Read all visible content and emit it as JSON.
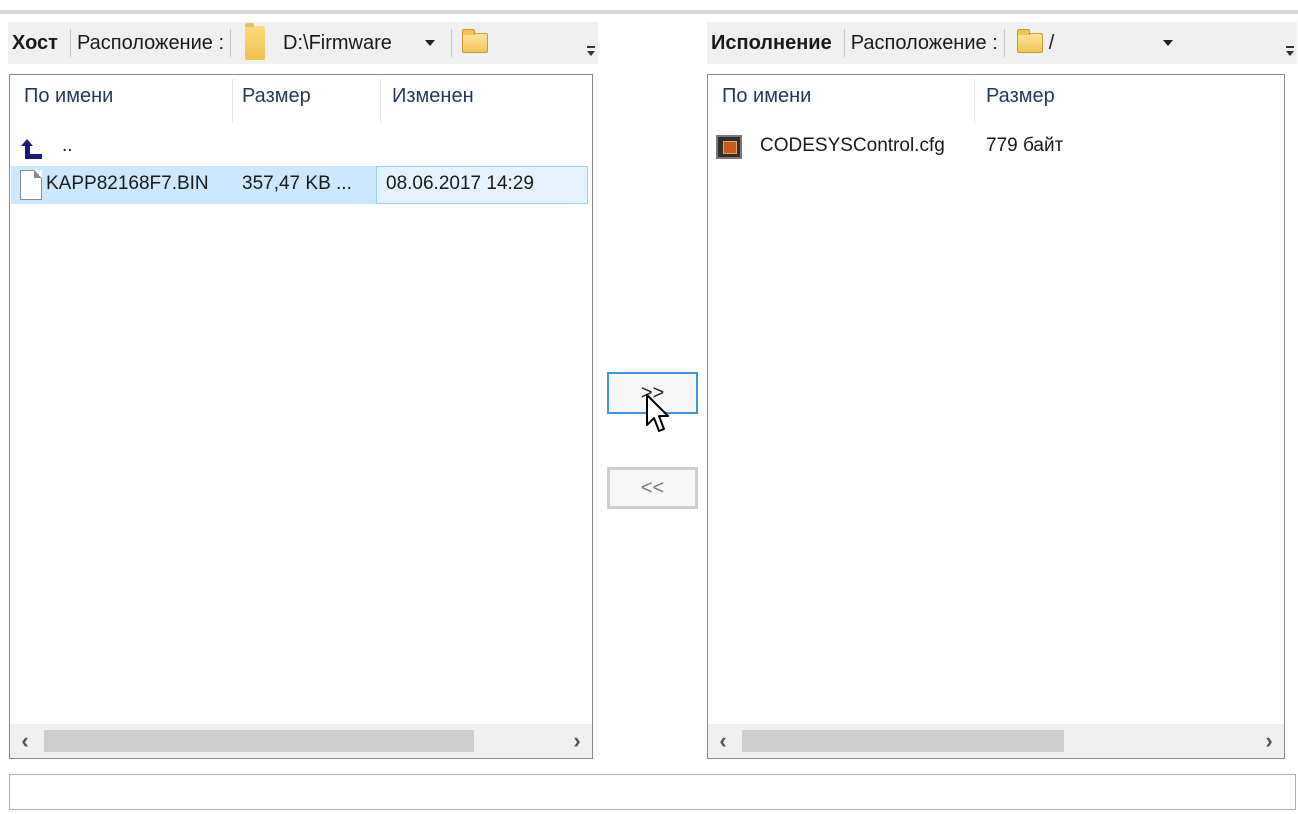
{
  "host": {
    "title": "Хост",
    "location_label": "Расположение :",
    "path": "D:\\Firmware",
    "columns": [
      "По имени",
      "Размер",
      "Изменен"
    ],
    "parent_entry": "..",
    "files": [
      {
        "name": "KAPP82168F7.BIN",
        "size": "357,47 KB ...",
        "modified": "08.06.2017 14:29"
      }
    ]
  },
  "runtime": {
    "title": "Исполнение",
    "location_label": "Расположение :",
    "path": "/",
    "columns": [
      "По имени",
      "Размер"
    ],
    "files": [
      {
        "name": "CODESYSControl.cfg",
        "size": "779 байт"
      }
    ]
  },
  "transfer": {
    "to_runtime_label": ">>",
    "to_host_label": "<<"
  },
  "status_text": "",
  "icons": {
    "folder": "folder-icon",
    "browse": "folder-browse-icon",
    "up": "up-level-icon",
    "file": "file-icon",
    "config": "config-file-icon",
    "scroll_left": "scroll-left-icon",
    "scroll_right": "scroll-right-icon"
  },
  "colors": {
    "selection": "#cce8ff",
    "selection_border": "#99d1ff",
    "active_button_border": "#3c96e0",
    "header_text": "#1e395b",
    "up_arrow": "#1a1a7a"
  }
}
